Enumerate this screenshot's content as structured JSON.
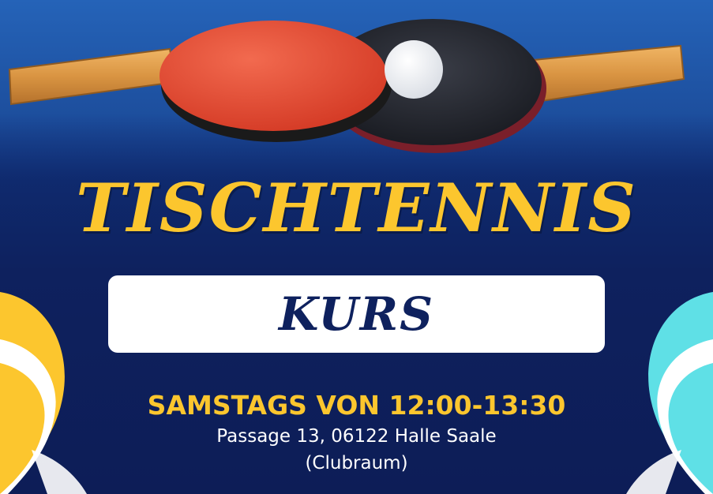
{
  "poster": {
    "title": "TISCHTENNIS",
    "subtitle": "KURS",
    "schedule": "SAMSTAGS VON 12:00-13:30",
    "address": "Passage 13, 06122 Halle Saale",
    "room": "(Clubraum)"
  },
  "colors": {
    "background": "#0e215e",
    "accent_yellow": "#fcc62e",
    "accent_cyan": "#5fe0e6",
    "badge": "#ffffff",
    "paddle_red": "#e8402b",
    "paddle_black": "#1b1d24"
  },
  "icons": {
    "left_deco": "yellow-wave-shape",
    "right_deco": "cyan-wave-shape",
    "photo": "table-tennis-paddles-and-ball"
  }
}
